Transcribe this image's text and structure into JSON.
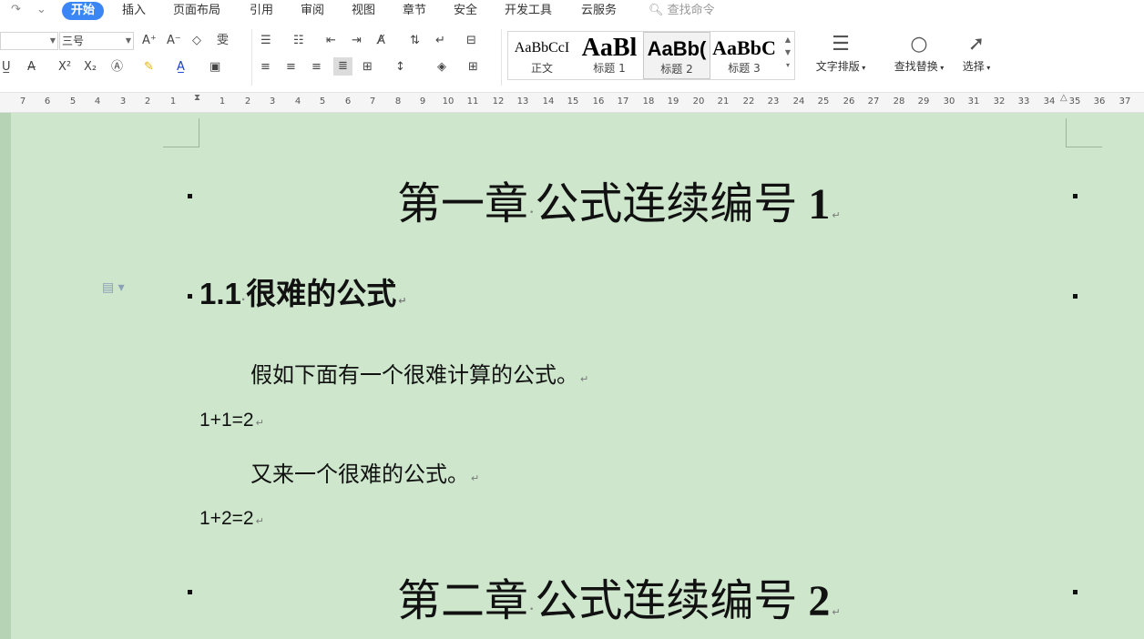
{
  "menubar": {
    "quick_access": [
      "↷",
      "⌄"
    ],
    "tabs": [
      "开始",
      "插入",
      "页面布局",
      "引用",
      "审阅",
      "视图",
      "章节",
      "安全",
      "开发工具",
      "云服务"
    ],
    "active_tab": "开始",
    "search_placeholder": "查找命令",
    "accent_color": "#3b86f5"
  },
  "ribbon": {
    "font_name": "",
    "font_size": "三号",
    "styles": [
      {
        "sample": "AaBbCcI",
        "name": "正文"
      },
      {
        "sample": "AaBl",
        "name": "标题 1"
      },
      {
        "sample": "AaBb(",
        "name": "标题 2"
      },
      {
        "sample": "AaBbC",
        "name": "标题 3"
      }
    ],
    "selected_style": "标题 2",
    "text_layout": "文字排版",
    "find_replace": "查找替换",
    "select": "选择"
  },
  "ruler": {
    "left_ticks": [
      "7",
      "6",
      "5",
      "4",
      "3",
      "2",
      "1"
    ],
    "right_ticks": [
      "1",
      "2",
      "3",
      "4",
      "5",
      "6",
      "7",
      "8",
      "9",
      "10",
      "11",
      "12",
      "13",
      "14",
      "15",
      "16",
      "17",
      "18",
      "19",
      "20",
      "21",
      "22",
      "23",
      "24",
      "25",
      "26",
      "27",
      "28",
      "29",
      "30",
      "31",
      "32",
      "33",
      "34",
      "35",
      "36",
      "37"
    ]
  },
  "document": {
    "background": "#cde6cc",
    "chapter1": {
      "prefix": "第一章",
      "title": "公式连续编号",
      "num": "1"
    },
    "section": {
      "num": "1.1",
      "title": "很难的公式"
    },
    "para1": "假如下面有一个很难计算的公式。",
    "formula1": "1+1=2",
    "para2": "又来一个很难的公式。",
    "formula2": "1+2=2",
    "chapter2": {
      "prefix": "第二章",
      "title": "公式连续编号",
      "num": "2"
    },
    "paragraph_mark": "↵"
  }
}
